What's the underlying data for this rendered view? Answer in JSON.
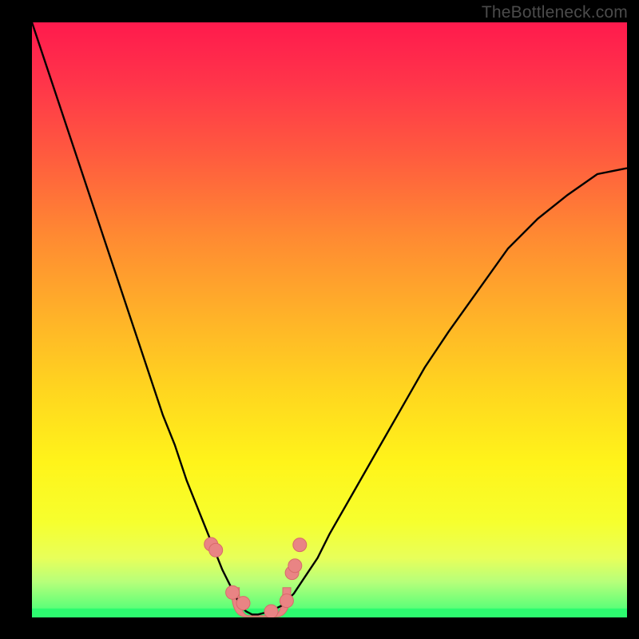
{
  "watermark": "TheBottleneck.com",
  "colors": {
    "curve": "#000000",
    "markerFill": "#e98484",
    "markerStroke": "#d86a6a",
    "fitBand": "#e98484",
    "greenBand": "#2dfb6f"
  },
  "chart_data": {
    "type": "line",
    "title": "",
    "xlabel": "",
    "ylabel": "",
    "xlim": [
      0,
      1
    ],
    "ylim": [
      0,
      1
    ],
    "series": [
      {
        "name": "bottleneck-curve",
        "x": [
          0.0,
          0.02,
          0.04,
          0.06,
          0.08,
          0.1,
          0.12,
          0.14,
          0.16,
          0.18,
          0.2,
          0.22,
          0.24,
          0.26,
          0.28,
          0.3,
          0.32,
          0.34,
          0.35,
          0.36,
          0.37,
          0.38,
          0.4,
          0.42,
          0.44,
          0.46,
          0.48,
          0.5,
          0.54,
          0.58,
          0.62,
          0.66,
          0.7,
          0.75,
          0.8,
          0.85,
          0.9,
          0.95,
          1.0
        ],
        "y": [
          1.0,
          0.94,
          0.88,
          0.82,
          0.76,
          0.7,
          0.64,
          0.58,
          0.52,
          0.46,
          0.4,
          0.34,
          0.29,
          0.23,
          0.18,
          0.13,
          0.08,
          0.04,
          0.02,
          0.01,
          0.005,
          0.005,
          0.01,
          0.02,
          0.04,
          0.07,
          0.1,
          0.14,
          0.21,
          0.28,
          0.35,
          0.42,
          0.48,
          0.55,
          0.62,
          0.67,
          0.71,
          0.745,
          0.755
        ]
      }
    ],
    "annotations": {
      "fit_region": {
        "x_start": 0.335,
        "x_end": 0.435
      },
      "markers": [
        {
          "x": 0.301,
          "y": 0.123
        },
        {
          "x": 0.309,
          "y": 0.113
        },
        {
          "x": 0.337,
          "y": 0.042
        },
        {
          "x": 0.355,
          "y": 0.024
        },
        {
          "x": 0.402,
          "y": 0.01
        },
        {
          "x": 0.428,
          "y": 0.028
        },
        {
          "x": 0.437,
          "y": 0.075
        },
        {
          "x": 0.442,
          "y": 0.087
        },
        {
          "x": 0.45,
          "y": 0.122
        }
      ]
    }
  }
}
